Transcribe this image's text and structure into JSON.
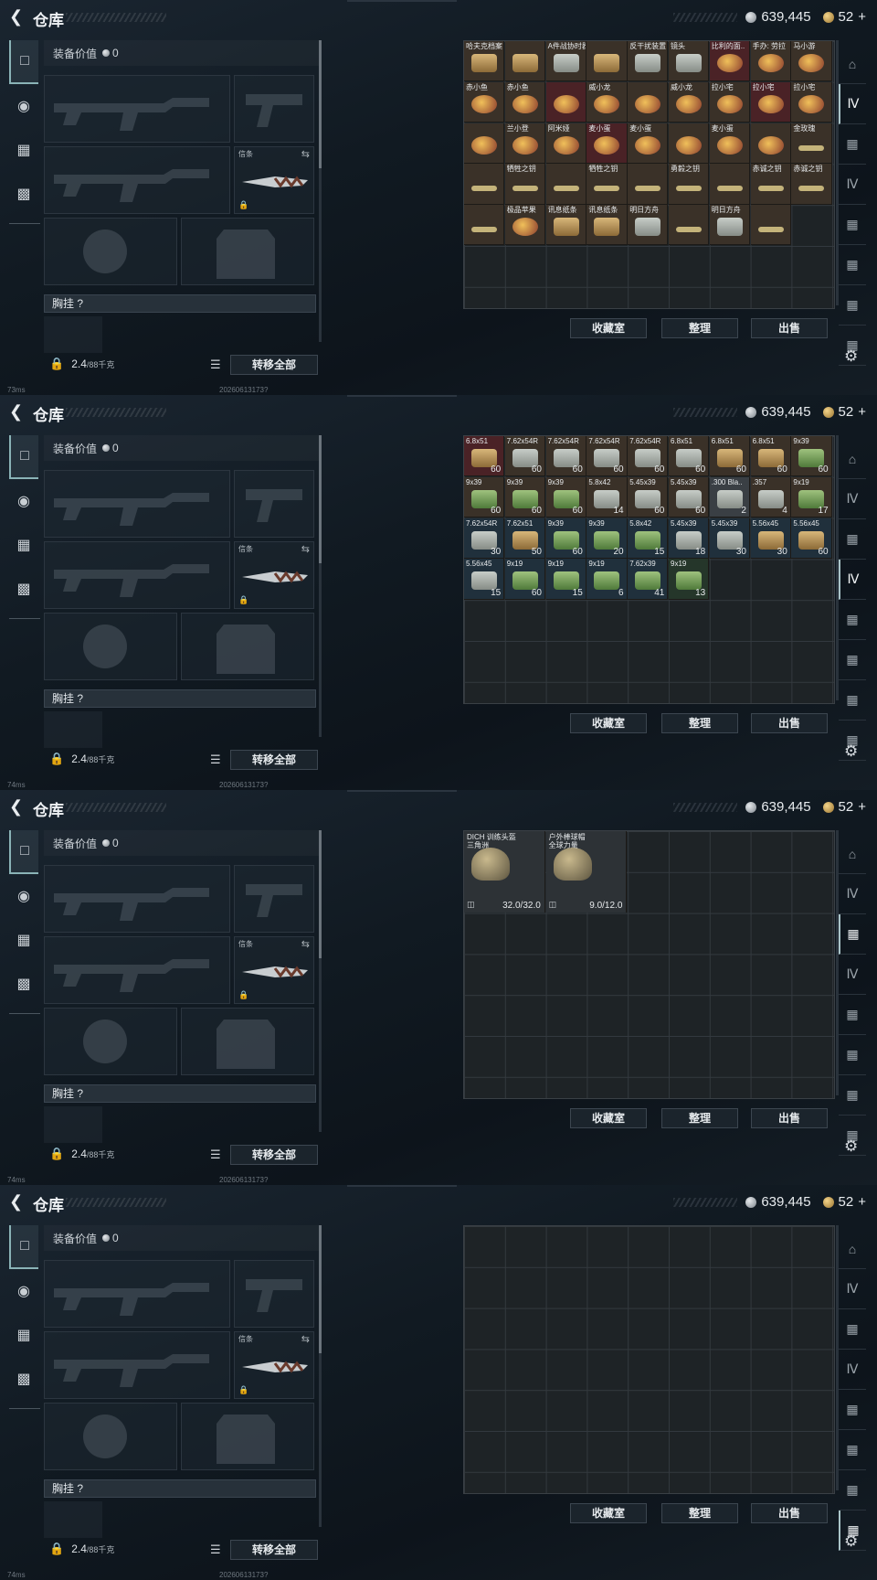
{
  "header": {
    "title": "仓库",
    "silver": "639,445",
    "gold": "52"
  },
  "loadout": {
    "value_label": "装备价值",
    "value": "0",
    "knife_label": "信条",
    "chest_label": "胸挂 ?",
    "weight": "2.4",
    "weight_max": "/88千克",
    "transfer_all": "转移全部"
  },
  "buttons": {
    "collection": "收藏室",
    "sort": "整理",
    "sell": "出售"
  },
  "icons": {
    "plus": "+",
    "back": "back-arrow-icon",
    "settings": "gear-icon"
  },
  "status": [
    {
      "ping": "73ms",
      "stamp": "20260613173?"
    },
    {
      "ping": "74ms",
      "stamp": "20260613173?"
    },
    {
      "ping": "74ms",
      "stamp": "20260613173?"
    },
    {
      "ping": "74ms",
      "stamp": "20260613173?"
    }
  ],
  "collectibles": [
    {
      "name": "哈夫克档案",
      "q": "",
      "c": "tan"
    },
    {
      "name": "",
      "q": "",
      "c": "tan"
    },
    {
      "name": "A件战协时器",
      "q": "",
      "c": "box"
    },
    {
      "name": "",
      "q": "",
      "c": "tan"
    },
    {
      "name": "反干扰装置",
      "q": "",
      "c": "box"
    },
    {
      "name": "镜头",
      "q": "",
      "c": "box"
    },
    {
      "name": "比利的面..",
      "q": "",
      "c": "doll"
    },
    {
      "name": "手办: 劳拉",
      "q": "",
      "c": "doll"
    },
    {
      "name": "马小游",
      "q": "",
      "c": "doll"
    },
    {
      "name": "赤小鱼",
      "q": "",
      "c": "doll"
    },
    {
      "name": "赤小鱼",
      "q": "",
      "c": "doll"
    },
    {
      "name": "",
      "q": "",
      "c": "doll"
    },
    {
      "name": "威小龙",
      "q": "",
      "c": "doll"
    },
    {
      "name": "",
      "q": "",
      "c": "doll"
    },
    {
      "name": "威小龙",
      "q": "",
      "c": "doll"
    },
    {
      "name": "拉小宅",
      "q": "",
      "c": "doll"
    },
    {
      "name": "拉小宅",
      "q": "",
      "c": "doll"
    },
    {
      "name": "拉小宅",
      "q": "",
      "c": "doll"
    },
    {
      "name": "",
      "q": "",
      "c": "doll"
    },
    {
      "name": "兰小登",
      "q": "",
      "c": "doll"
    },
    {
      "name": "阿米娅",
      "q": "",
      "c": "doll"
    },
    {
      "name": "麦小蛋",
      "q": "",
      "c": "doll"
    },
    {
      "name": "麦小蛋",
      "q": "",
      "c": "doll"
    },
    {
      "name": "",
      "q": "",
      "c": "doll"
    },
    {
      "name": "麦小蛋",
      "q": "",
      "c": "doll"
    },
    {
      "name": "",
      "q": "",
      "c": "doll"
    },
    {
      "name": "金玫瑰",
      "q": "",
      "c": "key"
    },
    {
      "name": "",
      "q": "",
      "c": "key"
    },
    {
      "name": "牺牲之钥",
      "q": "",
      "c": "key"
    },
    {
      "name": "",
      "q": "",
      "c": "key"
    },
    {
      "name": "牺牲之钥",
      "q": "",
      "c": "key"
    },
    {
      "name": "",
      "q": "",
      "c": "key"
    },
    {
      "name": "勇毅之钥",
      "q": "",
      "c": "key"
    },
    {
      "name": "",
      "q": "",
      "c": "key"
    },
    {
      "name": "赤诚之钥",
      "q": "",
      "c": "key"
    },
    {
      "name": "赤诚之钥",
      "q": "",
      "c": "key"
    },
    {
      "name": "",
      "q": "",
      "c": "key"
    },
    {
      "name": "极品苹果",
      "q": "",
      "c": "doll"
    },
    {
      "name": "讯息纸条",
      "q": "",
      "c": "tan"
    },
    {
      "name": "讯息纸条",
      "q": "",
      "c": "tan"
    },
    {
      "name": "明日方舟",
      "q": "",
      "c": "box"
    },
    {
      "name": "",
      "q": "",
      "c": "key"
    },
    {
      "name": "明日方舟",
      "q": "",
      "c": "box"
    },
    {
      "name": "",
      "q": "",
      "c": "key"
    }
  ],
  "ammo": [
    {
      "name": "6.8x51",
      "q": "60",
      "c": "red",
      "a": "tan"
    },
    {
      "name": "7.62x54R",
      "q": "60",
      "c": "",
      "a": "box"
    },
    {
      "name": "7.62x54R",
      "q": "60",
      "c": "",
      "a": "box"
    },
    {
      "name": "7.62x54R",
      "q": "60",
      "c": "",
      "a": "box"
    },
    {
      "name": "7.62x54R",
      "q": "60",
      "c": "",
      "a": "box"
    },
    {
      "name": "6.8x51",
      "q": "60",
      "c": "",
      "a": "box"
    },
    {
      "name": "6.8x51",
      "q": "60",
      "c": "",
      "a": "tan"
    },
    {
      "name": "6.8x51",
      "q": "60",
      "c": "",
      "a": "tan"
    },
    {
      "name": "9x39",
      "q": "60",
      "c": "",
      "a": "gbox"
    },
    {
      "name": "9x39",
      "q": "60",
      "c": "",
      "a": "gbox"
    },
    {
      "name": "9x39",
      "q": "60",
      "c": "",
      "a": "gbox"
    },
    {
      "name": "9x39",
      "q": "60",
      "c": "",
      "a": "gbox"
    },
    {
      "name": "5.8x42",
      "q": "14",
      "c": "",
      "a": "box"
    },
    {
      "name": "5.45x39",
      "q": "60",
      "c": "",
      "a": "box"
    },
    {
      "name": "5.45x39",
      "q": "60",
      "c": "",
      "a": "box"
    },
    {
      "name": ".300 Bla..",
      "q": "2",
      "c": "gray",
      "a": "box"
    },
    {
      "name": ".357",
      "q": "4",
      "c": "",
      "a": "box"
    },
    {
      "name": "9x19",
      "q": "17",
      "c": "",
      "a": "gbox"
    },
    {
      "name": "7.62x54R",
      "q": "30",
      "c": "blue",
      "a": "box"
    },
    {
      "name": "7.62x51",
      "q": "50",
      "c": "blue",
      "a": "tan"
    },
    {
      "name": "9x39",
      "q": "60",
      "c": "blue",
      "a": "gbox"
    },
    {
      "name": "9x39",
      "q": "20",
      "c": "blue",
      "a": "gbox"
    },
    {
      "name": "5.8x42",
      "q": "15",
      "c": "blue",
      "a": "gbox"
    },
    {
      "name": "5.45x39",
      "q": "18",
      "c": "blue",
      "a": "box"
    },
    {
      "name": "5.45x39",
      "q": "30",
      "c": "blue",
      "a": "box"
    },
    {
      "name": "5.56x45",
      "q": "30",
      "c": "blue",
      "a": "tan"
    },
    {
      "name": "5.56x45",
      "q": "60",
      "c": "blue",
      "a": "tan"
    },
    {
      "name": "5.56x45",
      "q": "15",
      "c": "blue",
      "a": "box"
    },
    {
      "name": "9x19",
      "q": "60",
      "c": "blue",
      "a": "gbox"
    },
    {
      "name": "9x19",
      "q": "15",
      "c": "blue",
      "a": "gbox"
    },
    {
      "name": "9x19",
      "q": "6",
      "c": "blue",
      "a": "gbox"
    },
    {
      "name": "7.62x39",
      "q": "41",
      "c": "blue",
      "a": "gbox"
    },
    {
      "name": "9x19",
      "q": "13",
      "c": "green",
      "a": "gbox"
    }
  ],
  "helmets": [
    {
      "name1": "DICH 训练头盔",
      "name2": "三角洲",
      "q": "32.0/32.0"
    },
    {
      "name1": "户外棒球帽",
      "name2": "全球力量",
      "q": "9.0/12.0"
    }
  ]
}
